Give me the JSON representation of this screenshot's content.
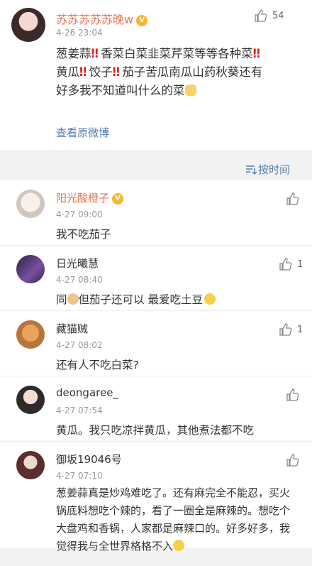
{
  "root": {
    "username": "苏苏苏苏苏晚w",
    "time": "4-26 23:04",
    "likes": "54",
    "lines": [
      [
        "葱姜蒜",
        "‼",
        "香菜白菜韭菜芹菜等等各种菜",
        "‼"
      ],
      [
        "黄瓜",
        "‼",
        "饺子",
        "‼",
        "茄子苦瓜南瓜山药秋葵还有"
      ],
      [
        "好多我不知道叫什么的菜"
      ]
    ],
    "view_original": "查看原微博"
  },
  "sort": {
    "label": "按时间"
  },
  "comments": [
    {
      "name": "阳光酸橙子",
      "time": "4-27 09:00",
      "text": "我不吃茄子",
      "likes": "",
      "vip": true
    },
    {
      "name": "日光曦慧",
      "time": "4-27 08:40",
      "text_a": "同",
      "text_b": "但茄子还可以 最爱吃土豆",
      "likes": "1",
      "vip": false
    },
    {
      "name": "藏猫贼",
      "time": "4-27 08:02",
      "text": "还有人不吃白菜?",
      "likes": "1",
      "vip": false
    },
    {
      "name": "deongaree_",
      "time": "4-27 07:54",
      "text": "黄瓜。我只吃凉拌黄瓜，其他煮法都不吃",
      "likes": "",
      "vip": false
    },
    {
      "name": "御坂19046号",
      "time": "4-27 07:10",
      "lines": [
        "葱姜蒜真是炒鸡难吃了。还有麻完全不能忍，买火",
        "锅底料想吃个辣的，看了一圈全是麻辣的。想吃个",
        "大盘鸡和香锅，人家都是麻辣口的。好多好多，我",
        "觉得我与全世界格格不入"
      ],
      "likes": "",
      "vip": false
    }
  ]
}
